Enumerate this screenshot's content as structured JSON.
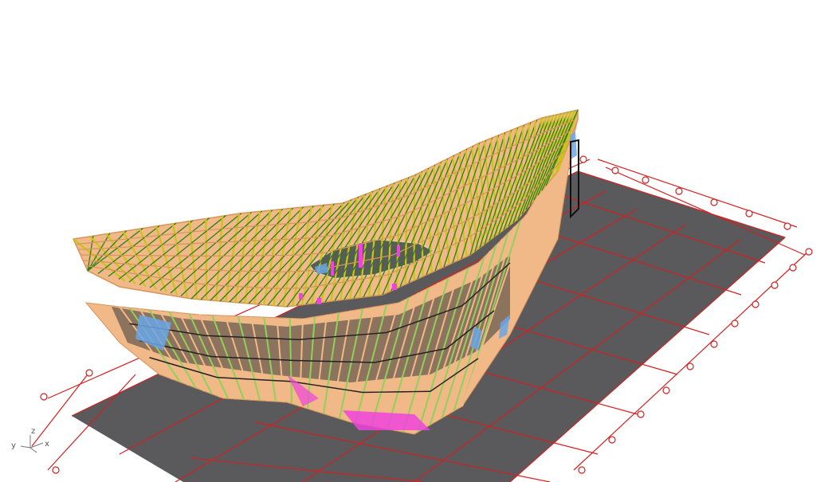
{
  "viewport": {
    "view_name": "",
    "background": "#ffffff",
    "colors": {
      "ground": "#5a5a5c",
      "grid_line": "#d42020",
      "shell_fill": "#f0b987",
      "shell_edge": "#d9935a",
      "member_yellow": "#c9c419",
      "member_green": "#2f7f18",
      "member_lightgreen": "#8fd15a",
      "accent_magenta": "#ee44dd",
      "accent_blue": "#6aa6e6",
      "facade_dark": "#3b3b3b"
    }
  },
  "model": {
    "name": "",
    "type": "stadium-shell-structural-model",
    "has_roof_opening": true
  },
  "axis_triad": {
    "x_label": "x",
    "y_label": "y",
    "z_label": "z"
  }
}
